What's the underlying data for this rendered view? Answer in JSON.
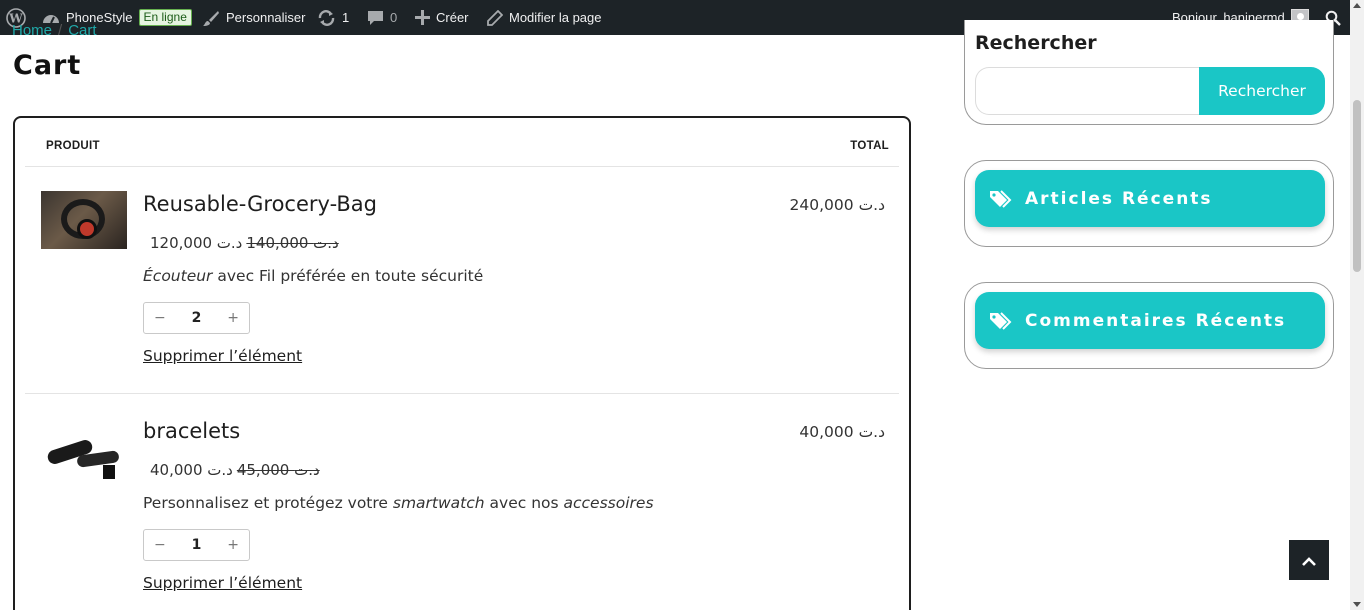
{
  "adminbar": {
    "site_name": "PhoneStyle",
    "status_badge": "En ligne",
    "customize_label": "Personnaliser",
    "updates_count": "1",
    "comments_count": "0",
    "new_label": "Créer",
    "edit_label": "Modifier la page",
    "greeting": "Bonjour, haninermd"
  },
  "breadcrumb": {
    "home": "Home",
    "separator": "/",
    "current": "Cart"
  },
  "page": {
    "title": "Cart"
  },
  "cart": {
    "header_product": "PRODUIT",
    "header_total": "TOTAL",
    "items": [
      {
        "name": "Reusable-Grocery-Bag",
        "price_current": "120,000 د.ت",
        "price_old": "140,000 د.ت",
        "desc_em": "Écouteur",
        "desc_rest": " avec Fil préférée en toute sécurité",
        "qty": "2",
        "remove_label": "Supprimer l’élément",
        "line_total": "240,000 د.ت",
        "image_icon": "headphones-image"
      },
      {
        "name": "bracelets",
        "price_current": "40,000 د.ت",
        "price_old": "45,000 د.ت",
        "desc_a": "Personnalisez et protégez votre ",
        "desc_em1": "smartwatch",
        "desc_b": " avec nos ",
        "desc_em2": "accessoires",
        "qty": "1",
        "remove_label": "Supprimer l’élément",
        "line_total": "40,000 د.ت",
        "image_icon": "watch-band-image"
      }
    ],
    "qty_minus": "−",
    "qty_plus": "+"
  },
  "sidebar": {
    "search_title": "Rechercher",
    "search_button": "Rechercher",
    "search_value": "",
    "recent_posts_title": "Articles Récents",
    "recent_comments_title": "Commentaires Récents"
  },
  "colors": {
    "accent": "#1ac6c6",
    "adminbar": "#1d2327",
    "badge_bg": "#e6f4e1"
  }
}
